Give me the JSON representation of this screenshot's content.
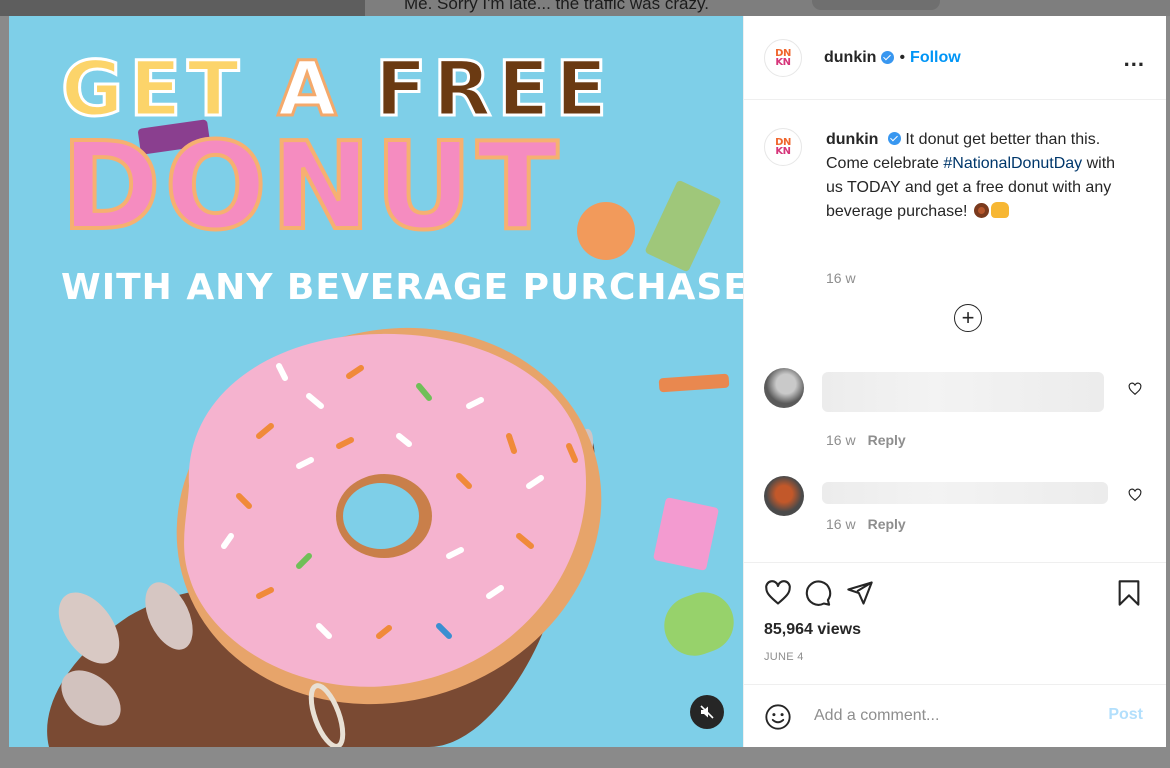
{
  "background": {
    "caption_text": "Me. Sorry I'm late... the traffic was crazy."
  },
  "media": {
    "headline_get": "GET",
    "headline_a": "A",
    "headline_free": "FREE",
    "headline_donut": "DONUT",
    "headline_sub": "WITH ANY BEVERAGE PURCHASE",
    "mute_icon": "muted-speaker-icon",
    "colors": {
      "sky": "#7ecfe8",
      "icing": "#f5b3cf",
      "dough": "#e7a46a"
    }
  },
  "header": {
    "username": "dunkin",
    "separator": "•",
    "follow_label": "Follow",
    "more_label": "..."
  },
  "logo": {
    "top": "DN",
    "bottom": "KN"
  },
  "caption": {
    "username": "dunkin",
    "text_before": "It donut get better than this. Come celebrate ",
    "hashtag": "#NationalDonutDay",
    "text_after": " with us TODAY and get a free donut with any beverage purchase! ",
    "time": "16 w"
  },
  "comments": [
    {
      "time": "16 w",
      "reply_label": "Reply"
    },
    {
      "time": "16 w",
      "reply_label": "Reply"
    }
  ],
  "actions": {
    "views": "85,964 views",
    "date": "JUNE 4"
  },
  "add_comment": {
    "placeholder": "Add a comment...",
    "post_label": "Post"
  },
  "icons": {
    "verified": "verified-badge-icon",
    "heart": "heart-icon",
    "comment": "comment-bubble-icon",
    "share": "paper-plane-icon",
    "save": "bookmark-icon",
    "emoji": "smiley-icon",
    "load_more": "plus-circle-icon"
  }
}
